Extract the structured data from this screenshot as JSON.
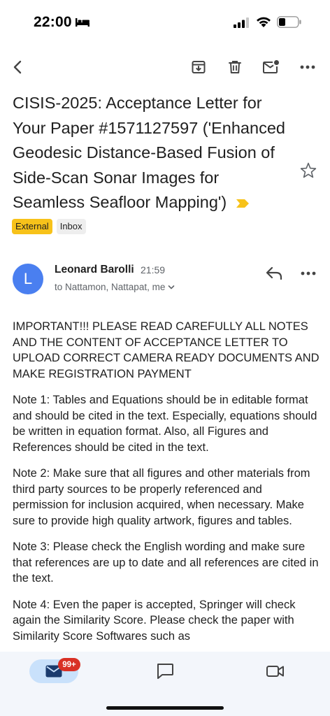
{
  "status_bar": {
    "time": "22:00",
    "icons": [
      "bed-icon",
      "signal-icon",
      "wifi-icon",
      "battery-icon"
    ]
  },
  "toolbar": {
    "icons": [
      "back-arrow-icon",
      "archive-icon",
      "trash-icon",
      "mark-unread-icon",
      "more-horizontal-icon"
    ]
  },
  "email": {
    "subject": "CISIS-2025: Acceptance Letter for Your Paper #1571127597 ('Enhanced Geodesic Distance-Based Fusion of Side-Scan Sonar Images for Seamless Seafloor Mapping')",
    "labels": [
      "External",
      "Inbox"
    ],
    "sender": {
      "initial": "L",
      "name": "Leonard Barolli",
      "time": "21:59",
      "recipients": "to Nattamon, Nattapat, me"
    },
    "body": [
      "IMPORTANT!!! PLEASE READ CAREFULLY ALL NOTES AND THE CONTENT OF ACCEPTANCE LETTER TO UPLOAD CORRECT CAMERA READY DOCUMENTS AND MAKE REGISTRATION PAYMENT",
      "Note 1: Tables and Equations should be in editable format and should be cited in the text. Especially, equations should be written in equation format. Also, all Figures and References should be cited in the text.",
      "Note 2: Make sure that all figures and other materials from third party sources to be properly referenced and permission for inclusion acquired, when necessary. Make sure to provide high quality artwork, figures and tables.",
      "Note 3: Please check the English wording and make sure that references are up to date and all references are cited in the text.",
      "Note 4: Even the paper is accepted, Springer will check again the Similarity Score. Please check the paper with Similarity Score Softwares such as"
    ]
  },
  "bottom_nav": {
    "mail_badge": "99+",
    "icons": [
      "mail-icon",
      "chat-icon",
      "video-icon"
    ]
  },
  "colors": {
    "accent": "#4a7ff0",
    "external_label": "#f7c21a",
    "badge": "#d93025",
    "nav_active": "#c9e1fb"
  }
}
